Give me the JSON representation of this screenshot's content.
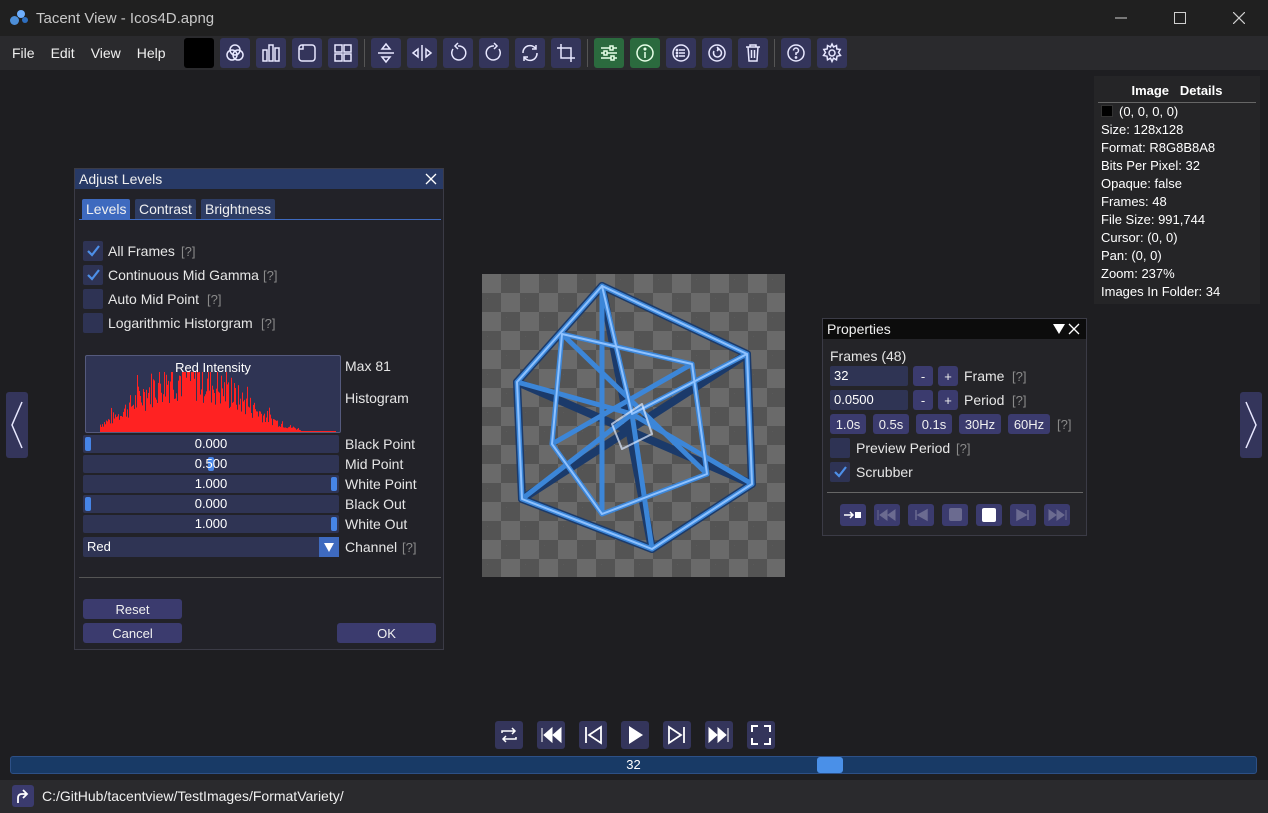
{
  "window": {
    "title": "Tacent View - Icos4D.apng"
  },
  "menu": {
    "items": [
      "File",
      "Edit",
      "View",
      "Help"
    ]
  },
  "levels": {
    "title": "Adjust Levels",
    "tabs": [
      "Levels",
      "Contrast",
      "Brightness"
    ],
    "options": [
      {
        "label": "All Frames",
        "checked": true
      },
      {
        "label": "Continuous Mid Gamma",
        "checked": true
      },
      {
        "label": "Auto Mid Point",
        "checked": false
      },
      {
        "label": "Logarithmic Historgram",
        "checked": false
      }
    ],
    "hint": "[?]",
    "histogram_title": "Red Intensity",
    "max_label": "Max 81",
    "histogram_label": "Histogram",
    "sliders": [
      {
        "value": "0.000",
        "label": "Black Point",
        "fraction": 0.0
      },
      {
        "value": "0.500",
        "label": "Mid Point",
        "fraction": 0.5
      },
      {
        "value": "1.000",
        "label": "White Point",
        "fraction": 1.0
      },
      {
        "value": "0.000",
        "label": "Black Out",
        "fraction": 0.0
      },
      {
        "value": "1.000",
        "label": "White Out",
        "fraction": 1.0
      }
    ],
    "channel_value": "Red",
    "channel_label": "Channel",
    "reset_label": "Reset",
    "cancel_label": "Cancel",
    "ok_label": "OK"
  },
  "details": {
    "header": "Image   Details",
    "pixel": "(0, 0, 0, 0)",
    "rows": [
      "Size: 128x128",
      "Format: R8G8B8A8",
      "Bits Per Pixel: 32",
      "Opaque: false",
      "Frames: 48",
      "File Size: 991,744",
      "Cursor: (0, 0)",
      "Pan: (0, 0)",
      "Zoom: 237%",
      "Images In Folder: 34"
    ]
  },
  "properties": {
    "title": "Properties",
    "frames_header": "Frames (48)",
    "frame_value": "32",
    "frame_label": "Frame",
    "period_value": "0.0500",
    "period_label": "Period",
    "minus": "-",
    "plus": "+",
    "presets": [
      "1.0s",
      "0.5s",
      "0.1s",
      "30Hz",
      "60Hz"
    ],
    "preview_period": "Preview Period",
    "scrubber": "Scrubber",
    "hint": "[?]"
  },
  "scrubber": {
    "value": "32"
  },
  "status": {
    "path": "C:/GitHub/tacentview/TestImages/FormatVariety/"
  },
  "colors": {
    "accent": "#3e6abf",
    "button": "#3b3b6e",
    "histogram": "#ff2222"
  }
}
